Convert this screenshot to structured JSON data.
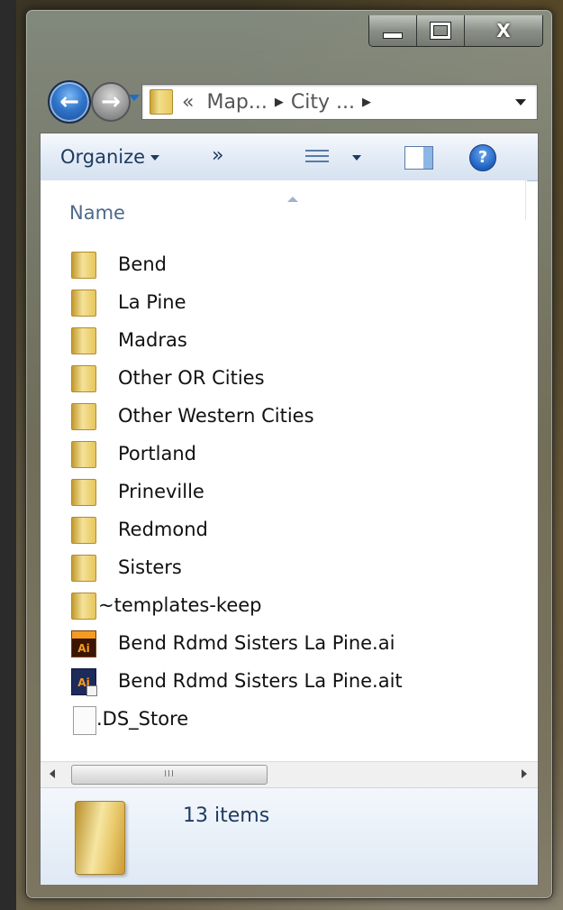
{
  "window": {
    "caption_buttons": [
      "minimize",
      "maximize",
      "close"
    ],
    "close_glyph": "X"
  },
  "navigation": {
    "back_icon": "back-arrow-icon",
    "forward_icon": "forward-arrow-icon",
    "breadcrumb_overflow": "«",
    "breadcrumb": [
      "Map...",
      "City ..."
    ]
  },
  "toolbar": {
    "organize_label": "Organize",
    "more_label": "»",
    "views_icon": "views-icon",
    "preview_icon": "preview-pane-icon",
    "help_label": "?"
  },
  "columns": {
    "name_label": "Name"
  },
  "files": [
    {
      "name": "Bend",
      "type": "folder"
    },
    {
      "name": "La Pine",
      "type": "folder"
    },
    {
      "name": "Madras",
      "type": "folder"
    },
    {
      "name": "Other OR Cities",
      "type": "folder"
    },
    {
      "name": "Other Western Cities",
      "type": "folder"
    },
    {
      "name": "Portland",
      "type": "folder"
    },
    {
      "name": "Prineville",
      "type": "folder"
    },
    {
      "name": "Redmond",
      "type": "folder"
    },
    {
      "name": "Sisters",
      "type": "folder"
    },
    {
      "name": "~templates-keep",
      "type": "folder"
    },
    {
      "name": "Bend Rdmd Sisters La Pine.ai",
      "type": "ai"
    },
    {
      "name": "Bend Rdmd Sisters La Pine.ait",
      "type": "ait"
    },
    {
      "name": ".DS_Store",
      "type": "file"
    }
  ],
  "scrollbar": {
    "thumb_grip": "III"
  },
  "details_pane": {
    "item_count": "13 items"
  },
  "icons": {
    "ai_label": "Ai"
  }
}
